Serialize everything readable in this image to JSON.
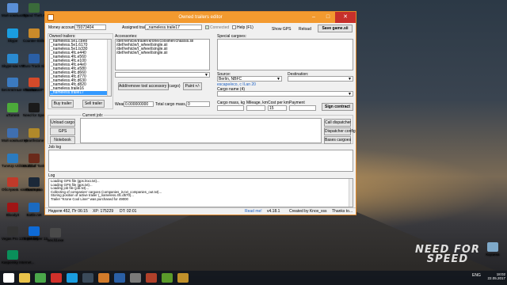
{
  "desktop": {
    "icons_left": [
      {
        "label": "Мой компьютер",
        "color": "#5a8fd6",
        "icon": "computer-icon"
      },
      {
        "label": "Skype",
        "color": "#1a9de0",
        "icon": "skype-icon"
      },
      {
        "label": "Skype-как VIP",
        "color": "#2a8ad0",
        "icon": "skype-icon"
      },
      {
        "label": "Бесплатные платежи...",
        "color": "#3b7ac0",
        "icon": "wallet-icon"
      },
      {
        "label": "uTorrent",
        "color": "#4caa3a",
        "icon": "utorrent-icon"
      },
      {
        "label": "Мой компьютер",
        "color": "#3f6fb0",
        "icon": "computer-icon"
      },
      {
        "label": "TuneUp Utilities 2014",
        "color": "#2b7bbf",
        "icon": "tuneup-icon"
      },
      {
        "label": "Обслужив. компьютера...",
        "color": "#c03a2a",
        "icon": "tool-icon"
      },
      {
        "label": "Bloody3",
        "color": "#a01515",
        "icon": "mouse-icon"
      },
      {
        "label": "Vegas Pro 13.0 (64-bit)",
        "color": "#333333",
        "icon": "vegas-icon"
      },
      {
        "label": "Kaspersky Internet...",
        "color": "#0a8f5a",
        "icon": "kaspersky-icon"
      }
    ],
    "icons_col2": [
      {
        "label": "Grand Theft Auto V",
        "color": "#3a6a3a",
        "icon": "gta-icon"
      },
      {
        "label": "Counter-Strike Global...",
        "color": "#c98a2a",
        "icon": "cs-icon"
      },
      {
        "label": "Euro Truck Simulator 2",
        "color": "#2a5fa5",
        "icon": "truck-icon"
      },
      {
        "label": "TruckersMP",
        "color": "#d44a2a",
        "icon": "truck-icon"
      },
      {
        "label": "Need for Speed",
        "color": "#1a1a1a",
        "icon": "nfs-icon"
      },
      {
        "label": "Hearthstone",
        "color": "#b0892a",
        "icon": "hearthstone-icon"
      },
      {
        "label": "World of Tanks",
        "color": "#6a2a1a",
        "icon": "wot-icon"
      },
      {
        "label": "Steam.exe",
        "color": "#1b2838",
        "icon": "steam-icon"
      },
      {
        "label": "Battle.net",
        "color": "#1a6ac0",
        "icon": "battlenet-icon"
      },
      {
        "label": "TeamViewer 12",
        "color": "#0e6ad6",
        "icon": "teamviewer-icon"
      }
    ],
    "icons_col3": [
      {
        "label": "",
        "color": "#d4a62a",
        "icon": "app-icon"
      },
      {
        "label": "",
        "color": "#2a2a2a",
        "icon": "app-icon"
      },
      {
        "label": "",
        "color": "#3a3a3a",
        "icon": "app-icon"
      },
      {
        "label": "",
        "color": "#c02a2a",
        "icon": "app-icon"
      },
      {
        "label": "",
        "color": "#2a5a9a",
        "icon": "app-icon"
      },
      {
        "label": "",
        "color": "#5a3a1a",
        "icon": "app-icon"
      },
      {
        "label": "",
        "color": "#6a6a6a",
        "icon": "app-icon"
      },
      {
        "label": "",
        "color": "#2a3a5a",
        "icon": "app-icon"
      },
      {
        "label": "",
        "color": "#3a5a3a",
        "icon": "app-icon"
      },
      {
        "label": "",
        "color": "#8a2a2a",
        "icon": "app-icon"
      },
      {
        "label": "hex.fd.exe",
        "color": "#4a4a4a",
        "icon": "hex-icon"
      }
    ],
    "recycle_label": "Корзина",
    "logo_text_1": "NEED FOR",
    "logo_text_2": "SPEED"
  },
  "window": {
    "title": "Owned trailers editor",
    "money_label": "Money account:",
    "money_value": "79373404",
    "assigned_label": "Assigned trailer:",
    "assigned_value": "_nameless.traile17",
    "connected_label": "Connected",
    "help_label": "Help (F1)",
    "show_gps": "Show GPS",
    "reload": "Reload",
    "save_game": "Save game.sii",
    "owned_label": "Owned trailers:",
    "owned_items": [
      "_nameless.5e1.c8e8",
      "_nameless.5e1.6170",
      "_nameless.5e1.b330",
      "_nameless.4fc.e440",
      "_nameless.4fc.e560",
      "_nameless.4fc.e100",
      "_nameless.4fc.e4e0",
      "_nameless.4fc.e580",
      "_nameless.4fc.d660",
      "_nameless.4fc.d770",
      "_nameless.4fc.d630",
      "_nameless.4fc.d820",
      "_nameless.traile16",
      "_nameless.traile17"
    ],
    "selected_owned_index": 13,
    "accessories_label": "Accessories:",
    "accessories_items": [
      "/def/vehicle/trailer/krone/coolliner/chassis.sii",
      "/def/vehicle/t_wheel/single.sii",
      "/def/vehicle/t_wheel/single.sii",
      "/def/vehicle/t_wheel/single.sii"
    ],
    "add_remove_btn": "Add/remove tool accessory (cargo)",
    "paint_btn": "Paint +/-",
    "buy_trailer": "Buy trailer",
    "sell_trailer": "Sell trailer",
    "wear_label": "Wear:",
    "wear_value": "0.000000000",
    "total_cargo_label": "Total cargo mass, kg:",
    "total_cargo_value": "0",
    "special_cargoes_label": "Special cargoes:",
    "source_label": "Source:",
    "source_value": "Berlin, NBFC",
    "source_link": "escape/eco, c II.an 20",
    "destination_label": "Destination:",
    "cargo_name_label": "Cargo name (4)",
    "cargo_mass_label": "Cargo mass, kg",
    "mileage_label": "Mileage, km",
    "cost_label": "Cost per km",
    "payment_label": "Payment",
    "cost_value": "15",
    "sign_contract": "Sign contract",
    "current_job_label": "Current job:",
    "unload_cargo": "Unload cargo",
    "gps_btn": "GPS",
    "notebook_btn": "Notebook",
    "call_dispatcher": "Call dispatcher",
    "dispatcher_config": "Dispatcher config",
    "bases_cargoes": "Bases cargoes",
    "job_log_label": "Job log",
    "log_label": "Log",
    "log_lines": [
      "Loading GPS file (gps.lnxo.txt)...",
      "Loading GPS file (gps.txt)...",
      "Loading job file (job.txt)...",
      "Collecting of companies' cargoes (companies_in.txt_companies_out.txt)...",
      "Storing position of active trailer (_nameless.4fc.d570)...",
      "Trailer \"Krone Cool Liner\" was purchased for 49000"
    ],
    "status": {
      "week": "Неделя 452, Пт 06:15",
      "xp": "XP: 175229",
      "dt": "DT: 02:01",
      "read_me": "Read me!",
      "version": "v4.18.1",
      "created": "Created by Knox_xss",
      "thanks": "Thanks to..."
    }
  },
  "taskbar": {
    "apps": [
      {
        "icon": "start-icon",
        "color": "#ffffff"
      },
      {
        "icon": "folder-icon",
        "color": "#e8c24a"
      },
      {
        "icon": "chrome-icon",
        "color": "#4aa74a"
      },
      {
        "icon": "opera-icon",
        "color": "#d0302a"
      },
      {
        "icon": "skype-icon",
        "color": "#1a9de0"
      },
      {
        "icon": "steam-icon",
        "color": "#3a4a5a"
      },
      {
        "icon": "media-icon",
        "color": "#d07a2a"
      },
      {
        "icon": "truck-icon",
        "color": "#2a5fa5"
      },
      {
        "icon": "app-icon",
        "color": "#7a7a7a"
      },
      {
        "icon": "app-icon",
        "color": "#b0402a"
      },
      {
        "icon": "app-icon",
        "color": "#5a9a2a"
      },
      {
        "icon": "app-icon",
        "color": "#c0902a"
      }
    ],
    "lang": "ENG",
    "time": "18:02",
    "date": "22.05.2017"
  }
}
